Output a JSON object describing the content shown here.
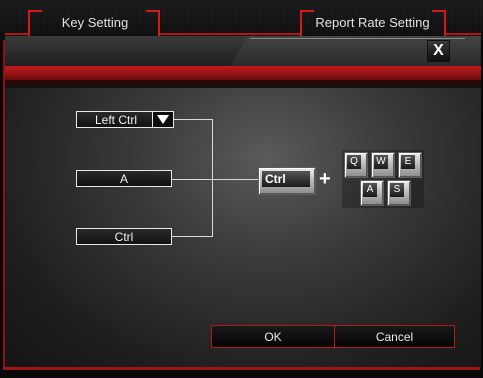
{
  "tabs": {
    "key_setting": "Key Setting",
    "report_rate_setting": "Report Rate Setting"
  },
  "header": {
    "close_label": "X"
  },
  "mapping": {
    "modifier_value": "Left Ctrl",
    "key_value": "A",
    "result_value": "Ctrl"
  },
  "preview": {
    "modifier_cap": "Ctrl",
    "plus": "+",
    "keys": [
      "Q",
      "W",
      "E",
      "A",
      "S"
    ]
  },
  "footer": {
    "ok_label": "OK",
    "cancel_label": "Cancel"
  },
  "colors": {
    "accent_red": "#c21a1a",
    "field_border": "#e8e8e8",
    "text": "#f0f0f0"
  }
}
